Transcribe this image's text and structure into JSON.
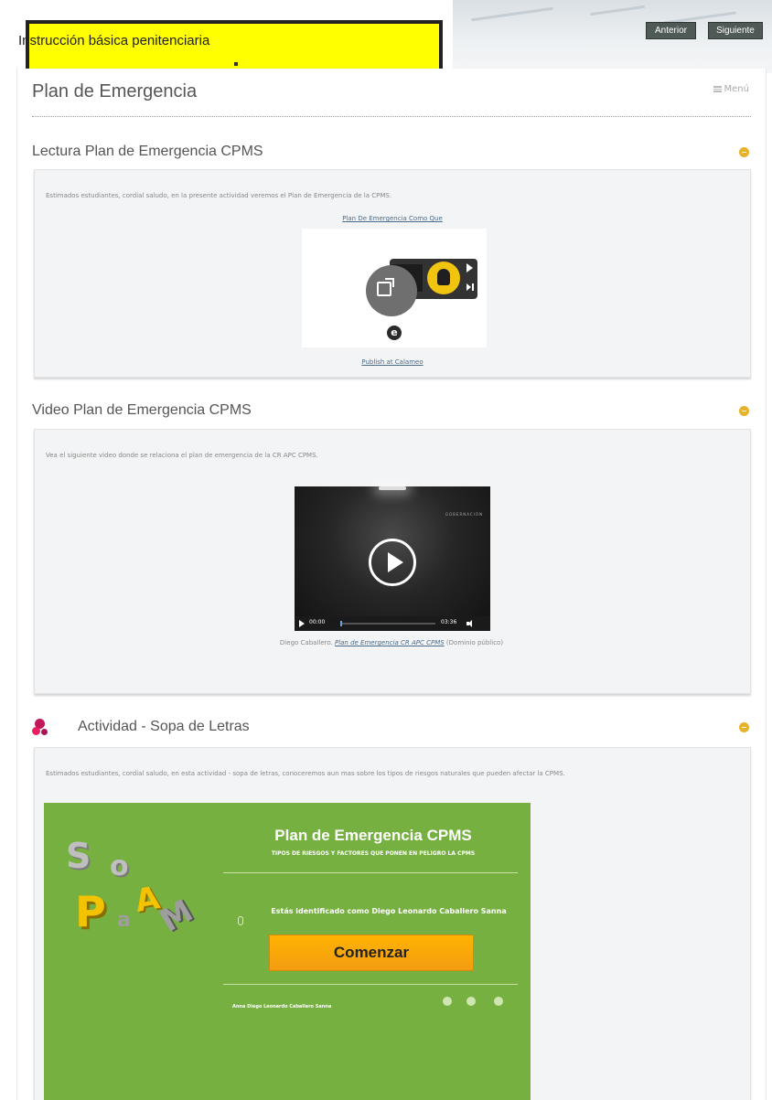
{
  "header": {
    "course_title": "Instrucción básica penitenciaria",
    "prev_label": "Anterior",
    "next_label": "Siguiente"
  },
  "page": {
    "title": "Plan de Emergencia",
    "menu_label": "Menú"
  },
  "sections": [
    {
      "title": "Lectura Plan de Emergencia CPMS",
      "intro": "Estimados estudiantes, cordial saludo, en la presente actividad veremos el Plan de Emergencia de la CPMS.",
      "link_top": "Plan De Emergencia Como Que",
      "link_bottom": "Publish at Calameo"
    },
    {
      "title": "Video Plan de Emergencia CPMS",
      "intro": "Vea el siguiente video donde se relaciona el plan de emergencia de la CR APC CPMS.",
      "video": {
        "watermark": "GOBERNACIÓN",
        "current_time": "00:00",
        "duration": "03:36"
      },
      "attribution_author": "Diego Caballero.",
      "attribution_link": "Plan de Emergencia CR APC CPMS",
      "attribution_license": "(Dominio público)"
    },
    {
      "title": "Actividad - Sopa de Letras",
      "intro": "Estimados estudiantes, cordial saludo, en esta actividad - sopa de letras, conoceremos aun mas sobre los tipos de riesgos naturales que pueden afectar la CPMS.",
      "game": {
        "logo_letters": [
          "S",
          "o",
          "P",
          "A",
          "M",
          "a"
        ],
        "title": "Plan de Emergencia CPMS",
        "subtitle": "TIPOS DE RIESGOS Y FACTORES QUE PONEN EN PELIGRO LA CPMS",
        "user_glyph": "8",
        "identified_text": "Estás identificado como Diego Leonardo Caballero Sanna",
        "start_label": "Comenzar",
        "footer_user": "Anna Diego Leonardo Caballero Sanna"
      }
    }
  ],
  "colors": {
    "course_tag_bg": "#ffff00",
    "collapse_icon": "#e7b22a",
    "game_bg": "#76b041",
    "start_button": "#f39c12",
    "activity_icon": "#c2185b"
  }
}
